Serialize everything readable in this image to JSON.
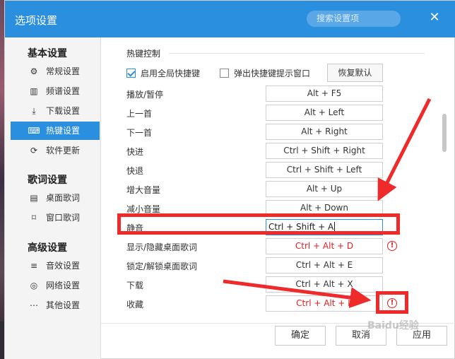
{
  "window": {
    "title": "选项设置",
    "search_placeholder": "搜索设置项",
    "close_icon": "close-icon"
  },
  "sidebar": {
    "sections": [
      {
        "title": "基本设置"
      },
      {
        "title": "歌词设置"
      },
      {
        "title": "高级设置"
      }
    ],
    "items": [
      {
        "label": "常规设置",
        "icon": "gear-icon",
        "glyph": "⚙"
      },
      {
        "label": "频谱设置",
        "icon": "spectrum-icon",
        "glyph": "▥"
      },
      {
        "label": "下载设置",
        "icon": "download-icon",
        "glyph": "⤓"
      },
      {
        "label": "热键设置",
        "icon": "keyboard-icon",
        "glyph": "⌨",
        "active": true
      },
      {
        "label": "软件更新",
        "icon": "update-icon",
        "glyph": "⟳"
      },
      {
        "label": "桌面歌词",
        "icon": "desktop-lyrics-icon",
        "glyph": "▤"
      },
      {
        "label": "窗口歌词",
        "icon": "window-lyrics-icon",
        "glyph": "⌑"
      },
      {
        "label": "音效设置",
        "icon": "equalizer-icon",
        "glyph": "≡"
      },
      {
        "label": "网络设置",
        "icon": "network-icon",
        "glyph": "◎"
      },
      {
        "label": "其他设置",
        "icon": "more-icon",
        "glyph": "⋯"
      }
    ]
  },
  "hotkeys": {
    "group_title": "热键控制",
    "enable_global": {
      "label": "启用全局快捷键",
      "checked": true
    },
    "show_tips": {
      "label": "弹出快捷键提示窗口",
      "checked": false
    },
    "reset_label": "恢复默认",
    "rows": [
      {
        "label": "播放/暂停",
        "value": "Alt + F5"
      },
      {
        "label": "上一首",
        "value": "Alt + Left"
      },
      {
        "label": "下一首",
        "value": "Alt + Right"
      },
      {
        "label": "快进",
        "value": "Ctrl + Shift + Right"
      },
      {
        "label": "快退",
        "value": "Ctrl + Shift + Left"
      },
      {
        "label": "增大音量",
        "value": "Alt + Up"
      },
      {
        "label": "减小音量",
        "value": "Alt + Down"
      },
      {
        "label": "静音",
        "value": "Ctrl + Shift + A",
        "editing": true
      },
      {
        "label": "显示/隐藏桌面歌词",
        "value": "Ctrl + Alt + D",
        "conflict": true
      },
      {
        "label": "锁定/解锁桌面歌词",
        "value": "Ctrl + Alt + E"
      },
      {
        "label": "下载",
        "value": "Ctrl + Alt + X"
      },
      {
        "label": "收藏",
        "value": "Ctrl + Alt + L",
        "conflict": true
      }
    ],
    "warn_glyph": "!"
  },
  "footer": {
    "ok": "确定",
    "cancel": "取消",
    "apply": "应用"
  },
  "watermark": "Baidu经验",
  "colors": {
    "accent": "#2b8fe0",
    "annotation_red": "#ee2a2a",
    "error_red": "#e02020"
  }
}
